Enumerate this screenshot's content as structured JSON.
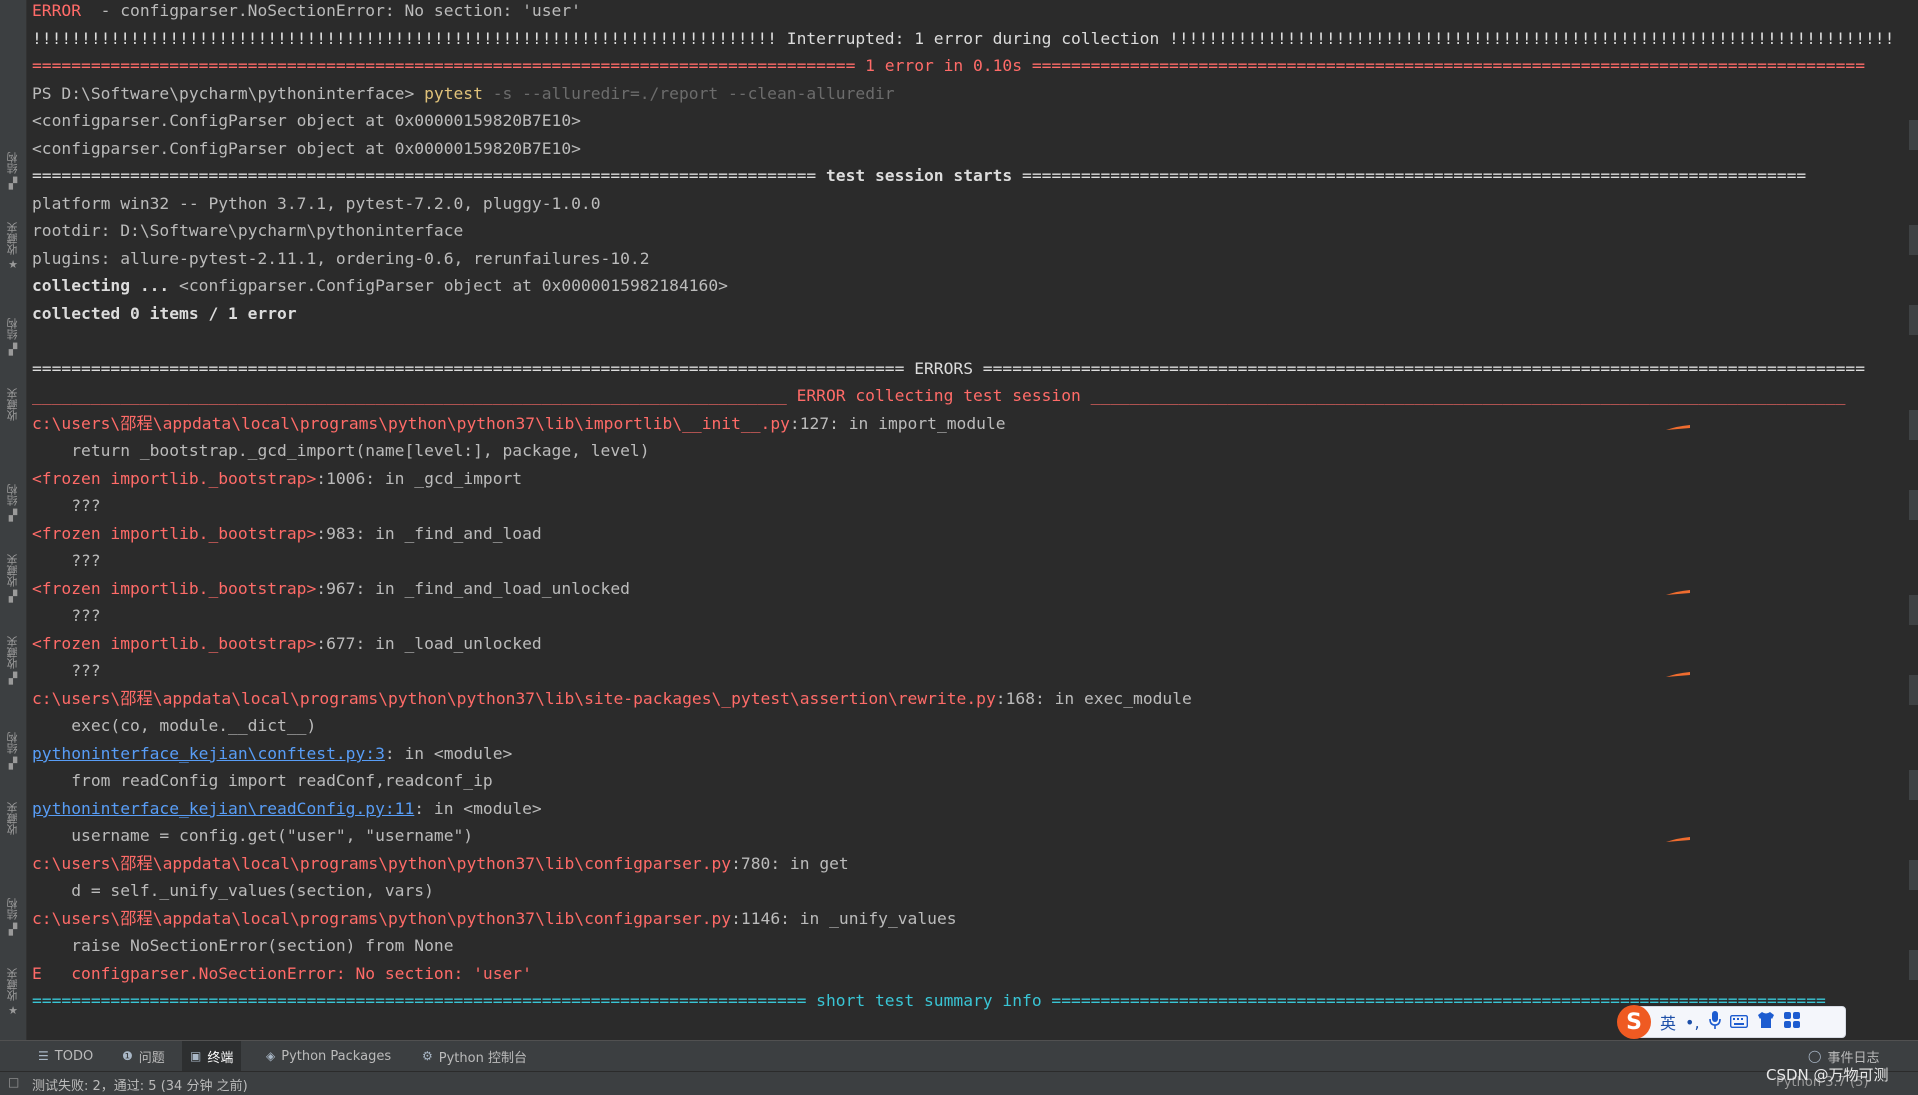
{
  "terminal": {
    "line_01": {
      "prefix": "ERROR",
      "rest": "  - configparser.NoSectionError: No section: 'user'"
    },
    "line_02": "!!!!!!!!!!!!!!!!!!!!!!!!!!!!!!!!!!!!!!!!!!!!!!!!!!!!!!!!!!!!!!!!!!!!!!!!!!!! Interrupted: 1 error during collection !!!!!!!!!!!!!!!!!!!!!!!!!!!!!!!!!!!!!!!!!!!!!!!!!!!!!!!!!!!!!!!!!!!!!!!!!!!",
    "line_03": "==================================================================================== 1 error in 0.10s =====================================================================================",
    "line_04": {
      "prompt": "PS D:\\Software\\pycharm\\pythoninterface> ",
      "command": "pytest",
      "args": " -s --alluredir=./report --clean-alluredir"
    },
    "line_05": "<configparser.ConfigParser object at 0x00000159820B7E10>",
    "line_06": "<configparser.ConfigParser object at 0x00000159820B7E10>",
    "line_07": {
      "left": "================================================================================ ",
      "title": "test session starts",
      "right": " ================================================================================"
    },
    "line_08": "platform win32 -- Python 3.7.1, pytest-7.2.0, pluggy-1.0.0",
    "line_09": "rootdir: D:\\Software\\pycharm\\pythoninterface",
    "line_10": "plugins: allure-pytest-2.11.1, ordering-0.6, rerunfailures-10.2",
    "line_11": {
      "bold": "collecting ... ",
      "rest": "<configparser.ConfigParser object at 0x0000015982184160>"
    },
    "line_12": "collected 0 items / 1 error",
    "line_13": "========================================================================================= ERRORS ==========================================================================================",
    "line_14": "_____________________________________________________________________________ ERROR collecting test session _____________________________________________________________________________",
    "line_15": {
      "path": "c:\\users\\邵程\\appdata\\local\\programs\\python\\python37\\lib\\importlib\\__init__.py",
      "rest": ":127: in import_module"
    },
    "line_16": "    return _bootstrap._gcd_import(name[level:], package, level)",
    "line_17": {
      "path": "<frozen importlib._bootstrap>",
      "rest": ":1006: in _gcd_import"
    },
    "line_18": "    ???",
    "line_19": {
      "path": "<frozen importlib._bootstrap>",
      "rest": ":983: in _find_and_load"
    },
    "line_20": "    ???",
    "line_21": {
      "path": "<frozen importlib._bootstrap>",
      "rest": ":967: in _find_and_load_unlocked"
    },
    "line_22": "    ???",
    "line_23": {
      "path": "<frozen importlib._bootstrap>",
      "rest": ":677: in _load_unlocked"
    },
    "line_24": "    ???",
    "line_25": {
      "path": "c:\\users\\邵程\\appdata\\local\\programs\\python\\python37\\lib\\site-packages\\_pytest\\assertion\\rewrite.py",
      "rest": ":168: in exec_module"
    },
    "line_26": "    exec(co, module.__dict__)",
    "line_27": {
      "link": "pythoninterface_kejian\\conftest.py:3",
      "rest": ": in <module>"
    },
    "line_28": "    from readConfig import readConf,readconf_ip",
    "line_29": {
      "link": "pythoninterface_kejian\\readConfig.py:11",
      "rest": ": in <module>"
    },
    "line_30": "    username = config.get(\"user\", \"username\")",
    "line_31": {
      "path": "c:\\users\\邵程\\appdata\\local\\programs\\python\\python37\\lib\\configparser.py",
      "rest": ":780: in get"
    },
    "line_32": "    d = self._unify_values(section, vars)",
    "line_33": {
      "path": "c:\\users\\邵程\\appdata\\local\\programs\\python\\python37\\lib\\configparser.py",
      "rest": ":1146: in _unify_values"
    },
    "line_34": "    raise NoSectionError(section) from None",
    "line_35": "E   configparser.NoSectionError: No section: 'user'",
    "line_36": {
      "left": "=============================================================================== ",
      "title": "short test summary info",
      "right": " ==============================================================================="
    }
  },
  "left_tabs": [
    {
      "label": "结构",
      "icon": "structure-icon"
    },
    {
      "label": "收藏夹",
      "icon": "star-icon"
    },
    {
      "label": "结构",
      "icon": "structure-icon"
    },
    {
      "label": "收藏夹",
      "icon": "star-icon"
    },
    {
      "label": "结构",
      "icon": "structure-icon"
    },
    {
      "label": "收藏夹",
      "icon": "star-icon"
    },
    {
      "label": "收藏夹",
      "icon": "star-icon"
    },
    {
      "label": "结构",
      "icon": "structure-icon"
    },
    {
      "label": "收藏夹",
      "icon": "star-icon"
    },
    {
      "label": "结构",
      "icon": "structure-icon"
    },
    {
      "label": "收藏夹",
      "icon": "star-icon"
    }
  ],
  "toolbar": {
    "todo": "TODO",
    "problems": "问题",
    "terminal": "终端",
    "python_packages": "Python Packages",
    "python_console": "Python 控制台",
    "event_log": "事件日志"
  },
  "statusbar": {
    "message": "测试失败: 2，通过: 5 (34 分钟 之前)",
    "interpreter": "Python 3.7 (5)"
  },
  "ime": {
    "logo": "S",
    "lang": "英",
    "punct": "•,"
  },
  "watermark": "CSDN @万物可测",
  "colors": {
    "background": "#2b2b2b",
    "error_red": "#ff6b68",
    "summary_cyan": "#39c5d5",
    "link_blue": "#589df6",
    "command_yellow": "#e0c27a"
  }
}
